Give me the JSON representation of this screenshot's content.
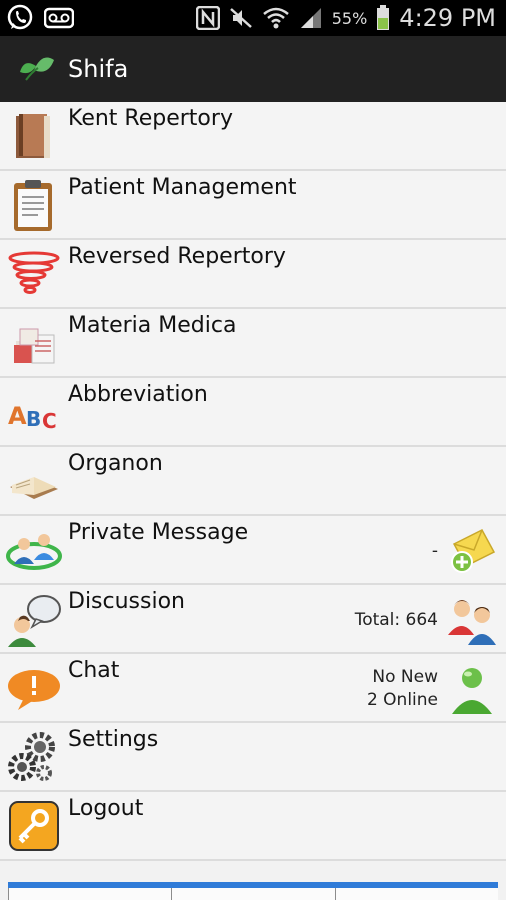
{
  "status_bar": {
    "battery_percent": "55%",
    "time": "4:29 PM",
    "icons": [
      "whatsapp-icon",
      "voicemail-icon",
      "nfc-icon",
      "mute-icon",
      "wifi-icon",
      "signal-icon",
      "battery-icon"
    ]
  },
  "app": {
    "title": "Shifa",
    "logo_icon": "leaf-icon",
    "accent_color": "#222222"
  },
  "menu": [
    {
      "label": "Kent Repertory",
      "icon": "book-icon"
    },
    {
      "label": "Patient Management",
      "icon": "clipboard-icon"
    },
    {
      "label": "Reversed Repertory",
      "icon": "tornado-icon"
    },
    {
      "label": "Materia Medica",
      "icon": "papers-icon"
    },
    {
      "label": "Abbreviation",
      "icon": "abc-icon"
    },
    {
      "label": "Organon",
      "icon": "open-book-icon"
    },
    {
      "label": "Private Message",
      "icon": "users-network-icon",
      "meta": "-",
      "right_icon": "envelope-add-icon"
    },
    {
      "label": "Discussion",
      "icon": "speech-person-icon",
      "meta": "Total: 664",
      "right_icon": "two-people-icon"
    },
    {
      "label": "Chat",
      "icon": "chat-bubble-icon",
      "meta_line1": "No New",
      "meta_line2": "2 Online",
      "right_icon": "online-user-icon"
    },
    {
      "label": "Settings",
      "icon": "gears-icon"
    },
    {
      "label": "Logout",
      "icon": "key-icon"
    }
  ]
}
